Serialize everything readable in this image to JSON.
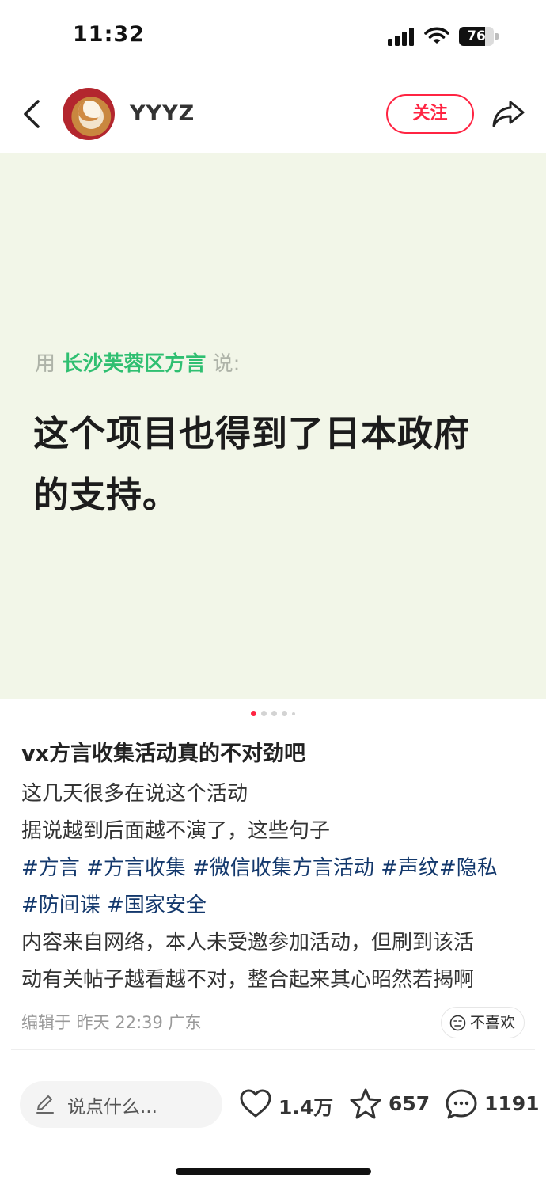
{
  "status_bar": {
    "time": "11:32",
    "battery": "76",
    "battery_level": 0.76
  },
  "header": {
    "username": "YYYZ",
    "follow_label": "关注"
  },
  "image": {
    "speaker_prefix": "用",
    "speaker_name": "长沙芙蓉区方言",
    "speaker_suffix": "说:",
    "quote_line1": "这个项目也得到了日本政府",
    "quote_line2": "的支持。",
    "page_count": 5,
    "active_page": 1
  },
  "post": {
    "title": "vx方言收集活动真的不对劲吧",
    "line1": "这几天很多在说这个活动",
    "line2": "据说越到后面越不演了，这些句子",
    "tags": [
      "#方言",
      "#方言收集",
      "#微信收集方言活动",
      "#声纹",
      "#隐私",
      "#防间谍",
      "#国家安全"
    ],
    "line3": "内容来自网络，本人未受邀参加活动，但刷到该活",
    "line4": "动有关帖子越看越不对，整合起来其心昭然若揭啊",
    "meta": "编辑于 昨天 22:39 广东",
    "dislike_label": "不喜欢"
  },
  "bottom_bar": {
    "comment_placeholder": "说点什么...",
    "likes": "1.4万",
    "collects": "657",
    "comments": "1191"
  },
  "colors": {
    "accent": "#ff2442",
    "tag": "#13386c",
    "speaker": "#2fbf71",
    "image_bg": "#f2f6e8"
  }
}
